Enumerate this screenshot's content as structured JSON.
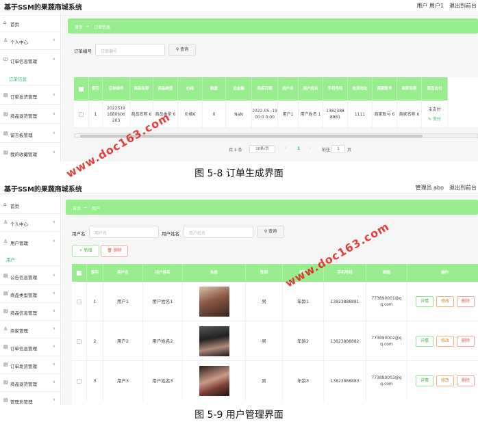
{
  "app_title": "基于SSM的果蔬商城系统",
  "watermark": "www.doc163.com",
  "screens": [
    {
      "top_user": "用户 用户1",
      "exit": "退出到前台",
      "menu": [
        {
          "icon": "⌂",
          "label": "首页"
        },
        {
          "icon": "♙",
          "label": "个人中心"
        },
        {
          "icon": "☑",
          "label": "订单信息管理"
        },
        {
          "label": "订单信息"
        },
        {
          "icon": "▤",
          "label": "订单发货管理"
        },
        {
          "icon": "▤",
          "label": "商品退货管理"
        },
        {
          "icon": "▤",
          "label": "留言板管理"
        },
        {
          "icon": "▤",
          "label": "我的收藏管理"
        }
      ],
      "crumb_home": "首页",
      "crumb_sep": "→",
      "crumb_current": "订单信息",
      "search_label": "订单编号",
      "search_placeholder": "订单编号",
      "query_button": "查询",
      "columns": [
        "索引",
        "订单编号",
        "商品名称",
        "商品类型",
        "价格",
        "数量",
        "总金额",
        "购买日期",
        "用户名",
        "用户姓名",
        "手机号码",
        "收货地址",
        "商家账号",
        "商家名称",
        "是否支付"
      ],
      "row": [
        "1",
        "2022519 1680606 203",
        "商品名称 6",
        "商品类型 6",
        "价格6",
        "0",
        "NaN",
        "2022-05 -19 00:0 0:00",
        "用户1",
        "用户姓名 1",
        "1382388 8881",
        "1111",
        "商家账号 6",
        "商家名称 6",
        "未支付"
      ],
      "pay_link": "支付",
      "pagination": {
        "total": "共 1 条",
        "size": "10条/页",
        "prev": "‹",
        "page": "1",
        "next": "›",
        "goto": "前往",
        "goto_value": "1",
        "page_unit": "页"
      }
    },
    {
      "top_user": "管理员 abo",
      "exit": "退出到前台",
      "menu": [
        {
          "icon": "⌂",
          "label": "首页"
        },
        {
          "icon": "♙",
          "label": "个人中心"
        },
        {
          "icon": "♙",
          "label": "用户管理"
        },
        {
          "label": "用户"
        },
        {
          "icon": "▤",
          "label": "公告信息管理"
        },
        {
          "icon": "▤",
          "label": "商品类型管理"
        },
        {
          "icon": "▤",
          "label": "商品信息管理"
        },
        {
          "icon": "♙",
          "label": "商家管理"
        },
        {
          "icon": "▤",
          "label": "订单信息管理"
        },
        {
          "icon": "▤",
          "label": "订单发货管理"
        },
        {
          "icon": "▤",
          "label": "商品退货管理"
        },
        {
          "icon": "▤",
          "label": "管理员管理"
        }
      ],
      "crumb_home": "首页",
      "crumb_sep": "→",
      "crumb_current": "用户",
      "search_label_1": "用户名",
      "search_placeholder_1": "用户名",
      "search_label_2": "用户姓名",
      "search_placeholder_2": "用户姓名",
      "query_button": "查询",
      "add_button": "新增",
      "delete_button": "删除",
      "columns": [
        "索引",
        "用户名",
        "用户姓名",
        "头像",
        "性别",
        "年龄",
        "手机号码",
        "邮箱",
        "操作"
      ],
      "rows": [
        {
          "index": "1",
          "username": "用户1",
          "name": "用户姓名1",
          "gender": "男",
          "age": "年龄1",
          "phone": "13823888881",
          "email": "773890001@q q.com"
        },
        {
          "index": "2",
          "username": "用户2",
          "name": "用户姓名2",
          "gender": "男",
          "age": "年龄2",
          "phone": "13823888882",
          "email": "773890002@q q.com"
        },
        {
          "index": "3",
          "username": "用户3",
          "name": "用户姓名3",
          "gender": "男",
          "age": "年龄3",
          "phone": "13823888883",
          "email": "773890003@q q.com"
        }
      ],
      "actions": {
        "detail": "详情",
        "edit": "修改",
        "delete": "删除"
      }
    }
  ],
  "captions": [
    "图 5-8 订单生成界面",
    "图 5-9 用户管理界面"
  ]
}
